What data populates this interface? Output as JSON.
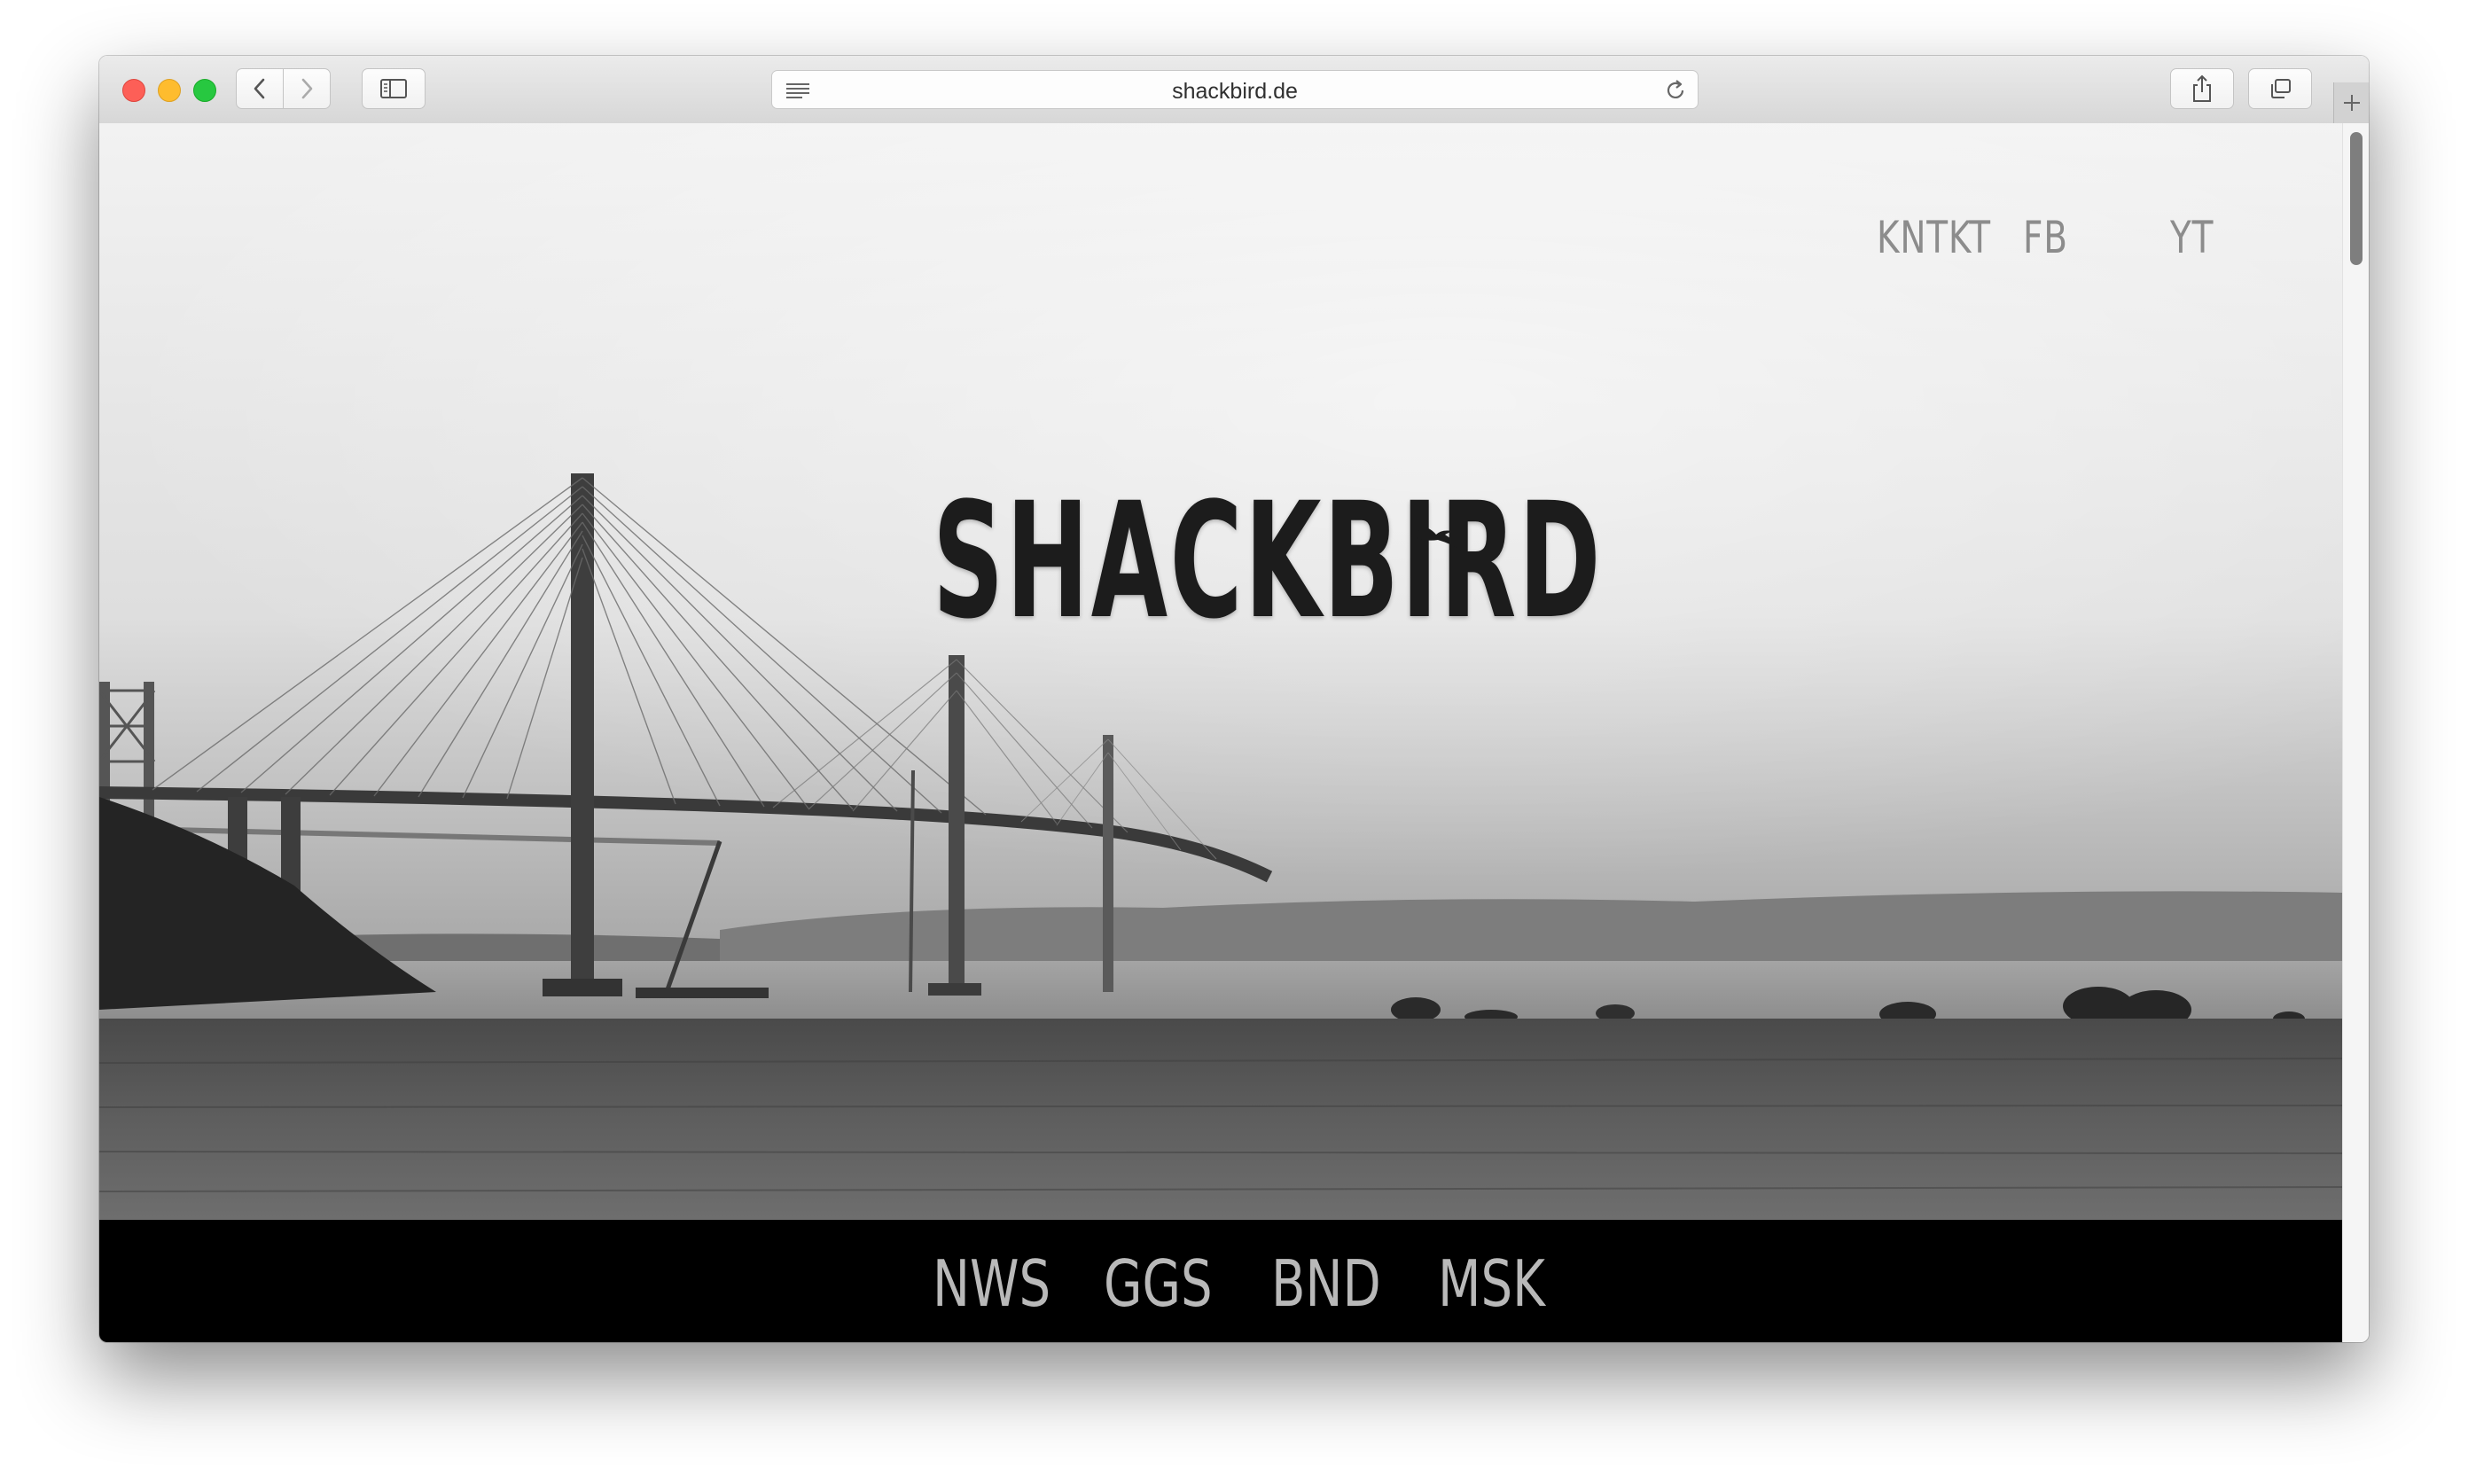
{
  "browser": {
    "url": "shackbird.de"
  },
  "site": {
    "logo_text": "SHACKBIRD",
    "top_nav": [
      "KNTKT",
      "FB",
      "YT"
    ],
    "bottom_nav": [
      "NWS",
      "GGS",
      "BND",
      "MSK"
    ]
  },
  "colors": {
    "bottom_bar": "#000000",
    "top_nav_text": "#8c8c8c",
    "bottom_nav_text": "#b9b9b9",
    "logo": "#1c1c1c"
  },
  "icons": [
    "back-chevron-icon",
    "forward-chevron-icon",
    "sidebar-icon",
    "reader-icon",
    "reload-icon",
    "share-icon",
    "tabs-icon",
    "plus-icon",
    "bird-icon"
  ]
}
